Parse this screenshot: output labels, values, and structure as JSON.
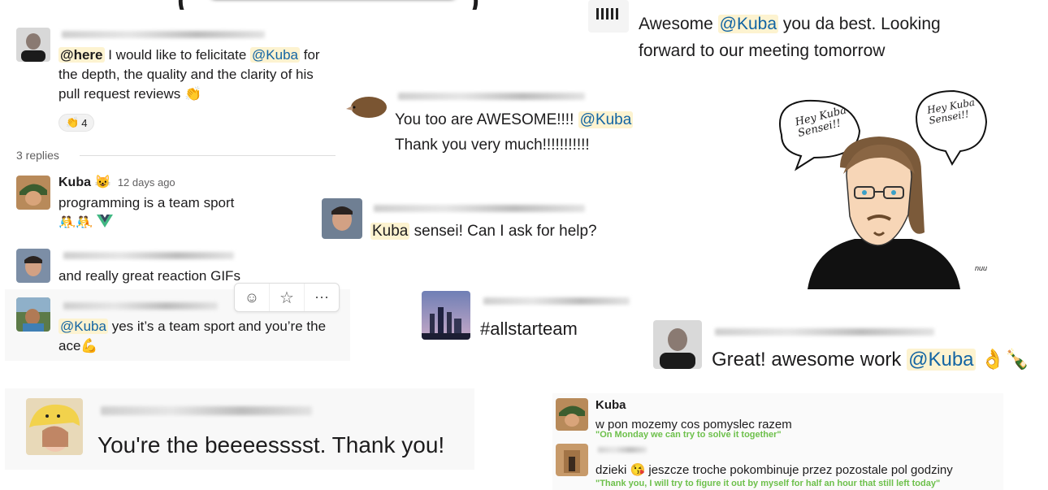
{
  "top_title_fragment": "(",
  "top_title_fragment_right": ")",
  "msg_here": {
    "mention_here": "@here",
    "text1": " I would like to felicitate ",
    "mention": "@Kuba",
    "text2": " for the depth, the quality and the clarity of his pull request reviews ",
    "emoji": "👏",
    "reaction_emoji": "👏",
    "reaction_count": "4"
  },
  "thread": {
    "replies_label": "3 replies",
    "kuba_name": "Kuba",
    "kuba_badge": "😺",
    "timestamp": "12 days ago",
    "reply1_text": "programming is a team sport",
    "reply1_emojis": "🤼🤼",
    "reply2_text": "and really great reaction GIFs",
    "reply3_mention": "@Kuba",
    "reply3_text": " yes it’s a team sport and you’re the ace",
    "reply3_emoji": "💪"
  },
  "toolbar": {
    "add_reaction": "☺",
    "star": "☆",
    "more": "⋯"
  },
  "msg_awesome": {
    "text1": "Awesome ",
    "mention": "@Kuba",
    "text2": " you da best. Looking forward to our meeting tomorrow"
  },
  "msg_too_awesome": {
    "text1": "You too are AWESOME!!!! ",
    "mention": "@Kuba",
    "text2": "Thank you very much!!!!!!!!!!!"
  },
  "msg_sensei": {
    "mention": "Kuba",
    "text": " sensei! Can I ask for help?"
  },
  "drawing": {
    "bubble_left": "Hey Kuba Sensei!!",
    "bubble_right": "Hey Kuba Sensei!!",
    "signature": "nuu"
  },
  "msg_allstar": {
    "text": "#allstarteam"
  },
  "msg_great": {
    "text1": "Great! awesome work ",
    "mention": "@Kuba",
    "emojis": "👌🍾"
  },
  "msg_beeest": {
    "text": "You're the beeeesssst. Thank you!"
  },
  "msg_polish": {
    "kuba_name": "Kuba",
    "line1": "w pon mozemy cos pomyslec razem",
    "line1_translation": "\"On Monday we can try to solve it together\"",
    "line2a": "dzieki ",
    "line2_emoji": "😘",
    "line2b": " jeszcze troche pokombinuje przez pozostale pol godziny",
    "line2_translation": "\"Thank you, I will try to figure it out by myself for half an hour that still left today\""
  },
  "colors": {
    "mention_bg": "#fdf3d0",
    "mention_fg": "#1264a3",
    "green": "#6dc04b"
  }
}
